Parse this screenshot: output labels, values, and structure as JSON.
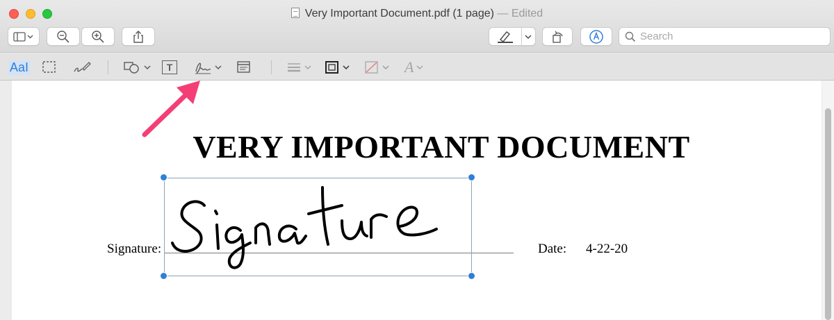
{
  "window": {
    "filename": "Very Important Document.pdf (1 page)",
    "status": "— Edited"
  },
  "toolbar": {
    "search_placeholder": "Search"
  },
  "markup_toolbar": {
    "text_style_label": "AaI",
    "text_box_label": "T",
    "font_style_label": "A"
  },
  "document": {
    "title": "VERY IMPORTANT DOCUMENT",
    "signature_label": "Signature:",
    "date_label": "Date:",
    "date_value": "4-22-20"
  },
  "colors": {
    "accent": "#2f7fd8",
    "annotation_arrow": "#f43f76"
  },
  "icons": [
    "sidebar-icon",
    "zoom-out-icon",
    "zoom-in-icon",
    "share-icon",
    "highlight-icon",
    "rotate-icon",
    "markup-icon",
    "search-icon",
    "rect-selection-icon",
    "sketch-icon",
    "shapes-icon",
    "signature-icon",
    "note-icon",
    "line-style-icon",
    "border-color-icon",
    "fill-color-icon",
    "chevron-down-icon"
  ]
}
